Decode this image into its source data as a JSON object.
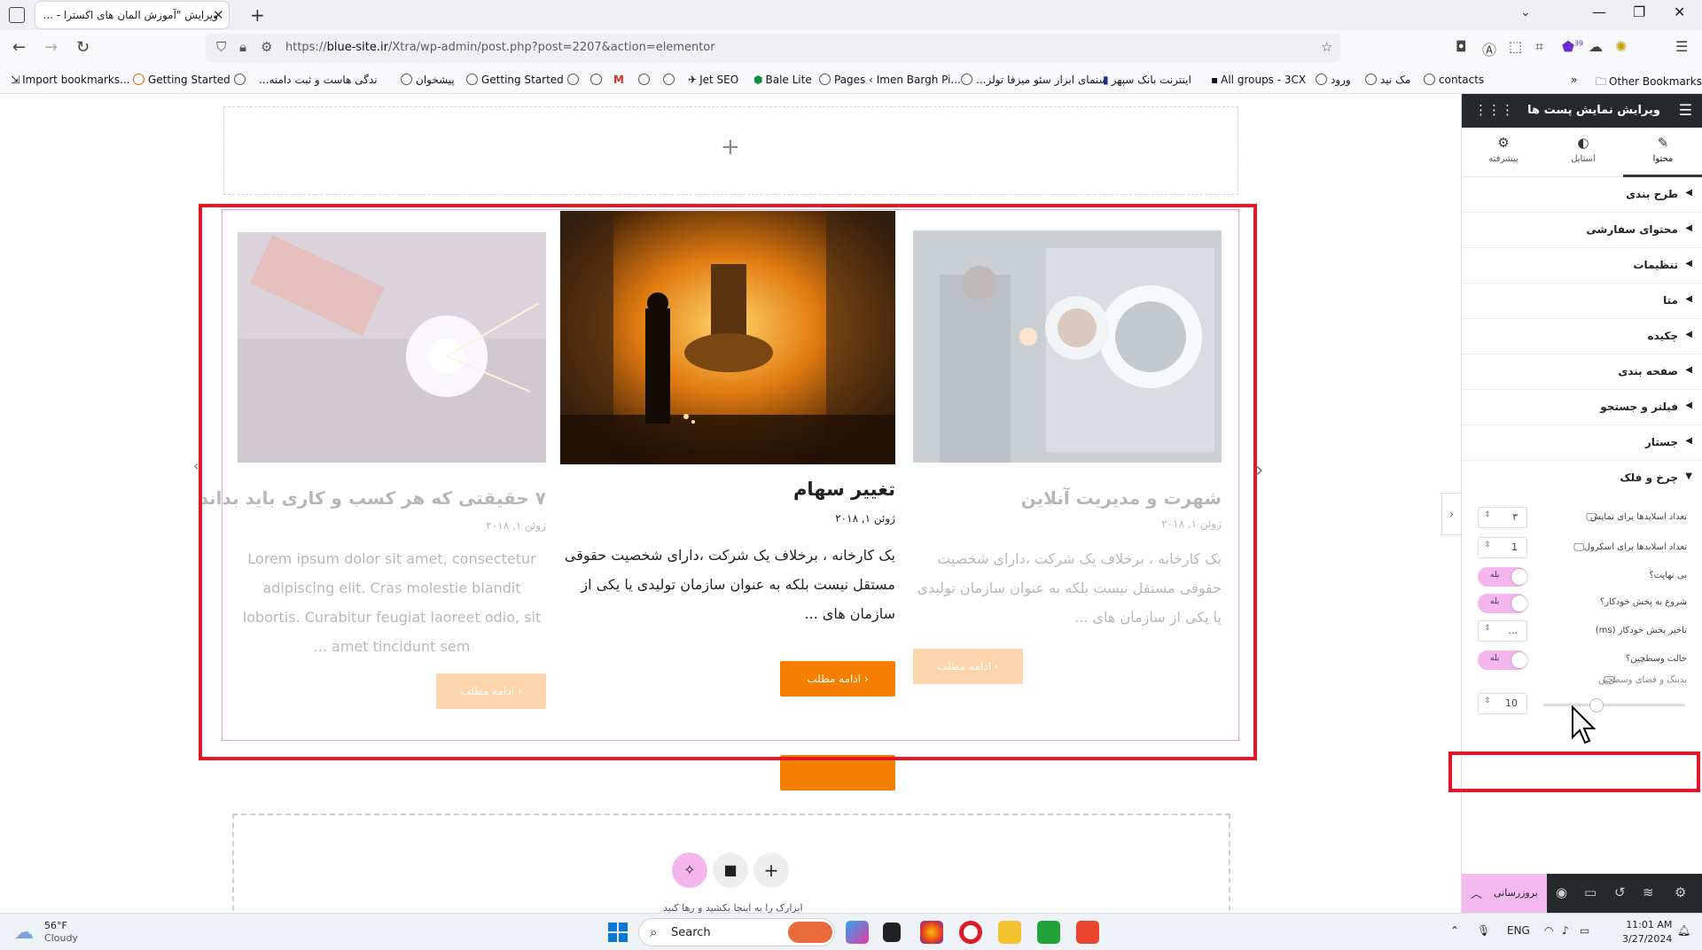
{
  "browser": {
    "tab_title": "ویرایش \"آموزش المان های اکسترا - ...",
    "url_prefix": "https://",
    "url_domain": "blue-site.ir",
    "url_path": "/Xtra/wp-admin/post.php?post=2207&action=elementor",
    "bookmarks": [
      "Import bookmarks...",
      "Getting Started",
      "...ندگی هاست و ثبت دامنه",
      "پیشخوان",
      "Getting Started",
      "Jet SEO",
      "Bale Lite",
      "Pages ‹ Imen Bargh Pi...",
      "...سنمای ابزار سئو میزفا تولز",
      "اینترنت بانک سپهر",
      "All groups - 3CX",
      "ورود",
      "مک نید",
      "contacts"
    ],
    "other_bookmarks": "Other Bookmarks",
    "extension_badge": "39"
  },
  "posts": [
    {
      "title": "شهرت و مدیریت آنلاین",
      "date": "ژوئن ۱, ۲۰۱۸",
      "excerpt": "یک کارخانه ، برخلاف یک شرکت ،دارای شخصیت حقوقی مستقل نیست بلکه به عنوان سازمان تولیدی یا یکی از سازمان های ...",
      "button": "ادامه مطلب",
      "state": "faded"
    },
    {
      "title": "تغییر سهام",
      "date": "ژوئن ۱, ۲۰۱۸",
      "excerpt": "یک کارخانه ، برخلاف یک شرکت ،دارای شخصیت حقوقی مستقل نیست بلکه به عنوان سازمان تولیدی یا یکی از سازمان های ...",
      "button": "ادامه مطلب",
      "state": "active"
    },
    {
      "title": "۷ حقیقتی که هر کسب و کاری باید بداند",
      "date": "ژوئن ۱, ۲۰۱۸",
      "excerpt": "Lorem ipsum dolor sit amet, consectetur adipiscing elit. Cras molestie blandit lobortis. Curabitur feugiat laoreet odio, sit amet tincidunt sem ...",
      "button": "ادامه مطلب",
      "state": "faded"
    }
  ],
  "canvas": {
    "drop_hint": "ابزارک را به اینجا بکشید و رها کنید"
  },
  "panel": {
    "title": "ویرایش نمایش پست ها",
    "tabs": [
      "محتوا",
      "استایل",
      "پیشرفته"
    ],
    "sections": [
      "طرح بندی",
      "محتوای سفارشی",
      "تنظیمات",
      "متا",
      "چکیده",
      "صفحه بندی",
      "فیلتر و جستجو",
      "جستار",
      "چرخ و فلک"
    ],
    "controls": {
      "slides_to_show_label": "تعداد اسلایدها برای نمایش",
      "slides_to_show_value": "۳",
      "slides_to_scroll_label": "تعداد اسلایدها برای اسکرول",
      "slides_to_scroll_value": "1",
      "infinite_label": "بی نهایت؟",
      "infinite_value": "بله",
      "autoplay_label": "شروع به پخش خودکار؟",
      "autoplay_value": "بله",
      "autoplay_delay_label": "تاخیر پخش خودکار (ms)",
      "autoplay_delay_value": "...",
      "center_mode_label": "حالت وسطچین؟",
      "center_mode_value": "بله",
      "center_padding_label": "پدینگ و فضای وسطچین",
      "center_padding_value": "10"
    },
    "footer_update": "بروزرسانی"
  },
  "taskbar": {
    "temp": "56°F",
    "condition": "Cloudy",
    "search": "Search",
    "lang": "ENG",
    "time": "11:01 AM",
    "date": "3/27/2024"
  },
  "colors": {
    "accent": "#f77f00",
    "selection": "#e0192a",
    "toggle": "#f5b6ee",
    "panel_dark": "#26292c"
  }
}
